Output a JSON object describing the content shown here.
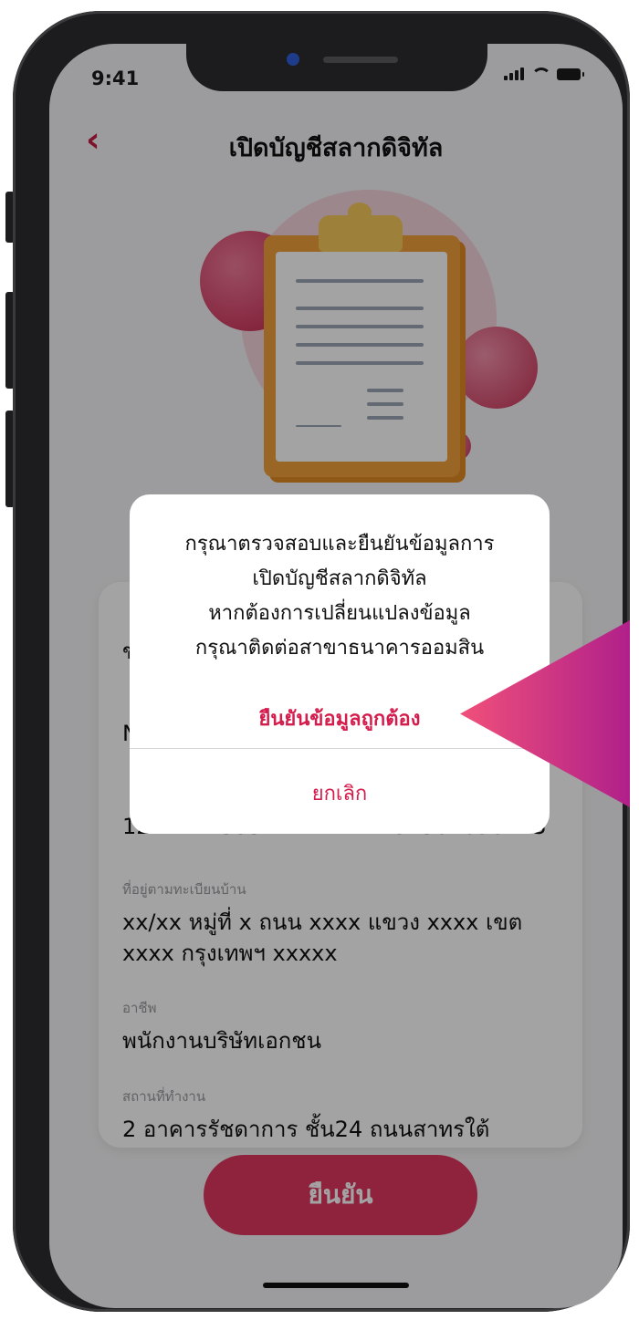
{
  "status_bar": {
    "time": "9:41"
  },
  "header": {
    "back_icon": "chevron-left-icon",
    "title": "เปิดบัญชีสลากดิจิทัล"
  },
  "form": {
    "fields": [
      {
        "label": "",
        "value": "ข"
      },
      {
        "label": "",
        "value": "N"
      },
      {
        "label": "",
        "value": "12 พ.ศ. 2535",
        "value2": "1234567890123"
      },
      {
        "label": "ที่อยู่ตามทะเบียนบ้าน",
        "value": "xx/xx หมู่ที่ x ถนน xxxx แขวง xxxx เขต xxxx กรุงเทพฯ xxxxx"
      },
      {
        "label": "อาชีพ",
        "value": "พนักงานบริษัทเอกชน"
      },
      {
        "label": "สถานที่ทำงาน",
        "value": "2 อาคารรัชดาการ ชั้น24 ถนนสาทรใต้"
      }
    ]
  },
  "confirm_button": {
    "label": "ยืนยัน"
  },
  "modal": {
    "message_lines": [
      "กรุณาตรวจสอบและยืนยันข้อมูลการ",
      "เปิดบัญชีสลากดิจิทัล",
      "หากต้องการเปลี่ยนแปลงข้อมูล",
      "กรุณาติดต่อสาขาธนาคารออมสิน"
    ],
    "confirm_label": "ยืนยันข้อมูลถูกต้อง",
    "cancel_label": "ยกเลิก"
  },
  "colors": {
    "accent": "#d41d4d",
    "button": "#e0365f",
    "pointer_start": "#f0507a",
    "pointer_end": "#b0208a"
  }
}
